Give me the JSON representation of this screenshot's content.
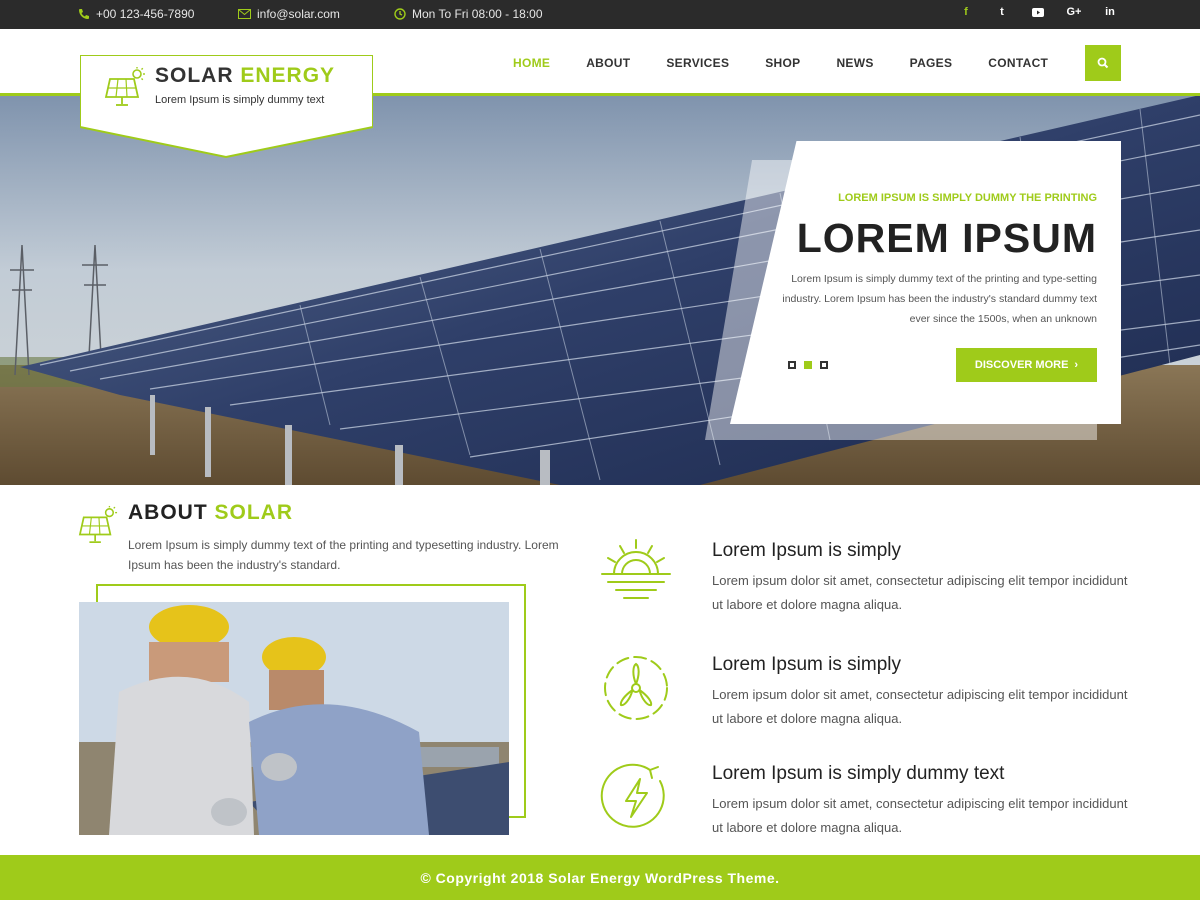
{
  "topbar": {
    "phone": "+00 123-456-7890",
    "email": "info@solar.com",
    "hours": "Mon To Fri 08:00 - 18:00",
    "social": [
      "f",
      "t",
      "yt",
      "G+",
      "in"
    ]
  },
  "logo": {
    "title_part1": "SOLAR",
    "title_part2": "ENERGY",
    "tagline": "Lorem Ipsum is simply dummy text"
  },
  "nav": [
    "HOME",
    "ABOUT",
    "SERVICES",
    "SHOP",
    "NEWS",
    "PAGES",
    "CONTACT"
  ],
  "hero": {
    "subtitle": "LOREM IPSUM IS SIMPLY DUMMY THE PRINTING",
    "title": "LOREM IPSUM",
    "text": "Lorem Ipsum is simply dummy text of the printing and type-setting industry. Lorem Ipsum has been the industry's standard dummy text ever since the 1500s, when an unknown",
    "button": "DISCOVER MORE",
    "button_arrow": "›"
  },
  "about": {
    "title_part1": "ABOUT",
    "title_part2": "SOLAR",
    "text": "Lorem Ipsum is simply dummy text of the printing and typesetting industry. Lorem Ipsum has been the industry's standard."
  },
  "features": [
    {
      "icon": "sun-icon",
      "title": "Lorem Ipsum is simply",
      "text": "Lorem ipsum dolor sit amet, consectetur adipiscing elit tempor incididunt ut labore et dolore magna aliqua."
    },
    {
      "icon": "wind-turbine-icon",
      "title": "Lorem Ipsum is simply",
      "text": "Lorem ipsum dolor sit amet, consectetur adipiscing elit tempor incididunt ut labore et dolore magna aliqua."
    },
    {
      "icon": "energy-bolt-icon",
      "title": "Lorem Ipsum is simply dummy text",
      "text": "Lorem ipsum dolor sit amet, consectetur adipiscing elit tempor incididunt ut labore et dolore magna aliqua."
    }
  ],
  "footer": {
    "copyright": "© Copyright 2018 Solar Energy WordPress Theme."
  },
  "colors": {
    "accent": "#9fcb1a",
    "topbar_bg": "#2b2b2b"
  }
}
